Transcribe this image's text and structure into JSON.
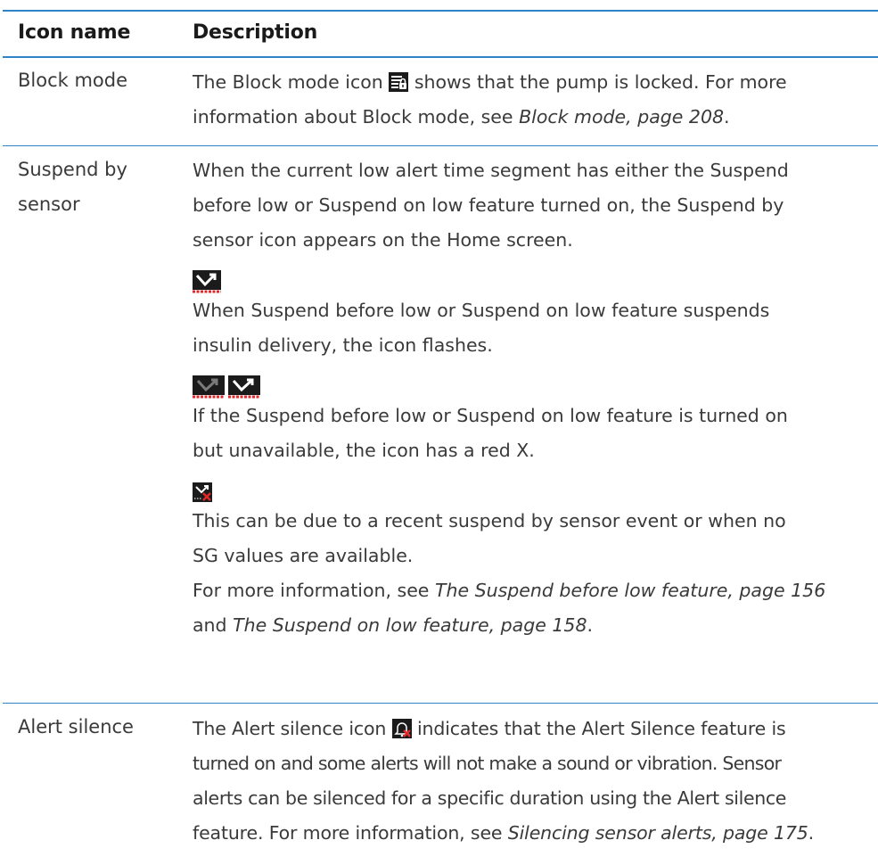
{
  "table": {
    "headers": {
      "icon_name": "Icon name",
      "description": "Description"
    },
    "rows": [
      {
        "name": "Block mode",
        "lines": {
          "l1_before": "The Block mode icon",
          "l1_after": "shows that the pump is locked. For more",
          "l2_before": "information about Block mode, see",
          "l2_ref": "Block mode, page 208",
          "l2_after": "."
        }
      },
      {
        "name_line1": "Suspend by",
        "name_line2": "sensor",
        "lines": {
          "p1_l1": "When the current low alert time segment has either the Suspend",
          "p1_l2": "before low or Suspend on low feature turned on, the Suspend by",
          "p1_l3": "sensor icon appears on the Home screen.",
          "p2_l1": "When Suspend before low or Suspend on low feature suspends",
          "p2_l2": "insulin delivery, the icon flashes.",
          "p3_l1": "If the Suspend before low or Suspend on low feature is turned on",
          "p3_l2": "but unavailable, the icon has a red X.",
          "p4_l1": "This can be due to a recent suspend by sensor event or when no",
          "p4_l2": "SG values are available.",
          "p5_l1_before": "For more information, see",
          "p5_l1_ref": "The Suspend before low feature, page 156",
          "p5_l2_before": "and",
          "p5_l2_ref": "The Suspend on low feature, page 158",
          "p5_l2_after": "."
        }
      },
      {
        "name": "Alert silence",
        "lines": {
          "l1_before": "The Alert silence icon",
          "l1_after": "indicates that the Alert Silence feature is",
          "l2": "turned on and some alerts will not make a sound or vibration. Sensor",
          "l3": "alerts can be silenced for a specific duration using the Alert silence",
          "l4_before": "feature. For more information, see",
          "l4_ref": "Silencing sensor alerts, page 175",
          "l4_after": "."
        }
      }
    ]
  },
  "colors": {
    "rule": "#2e84c7",
    "text": "#3a3a3a",
    "icon_dark": "#1b1b1b",
    "icon_red": "#e3262a"
  },
  "icons": [
    "block-mode-icon",
    "suspend-by-sensor-icon",
    "suspend-flashing-icon",
    "suspend-unavailable-icon",
    "alert-silence-icon"
  ]
}
